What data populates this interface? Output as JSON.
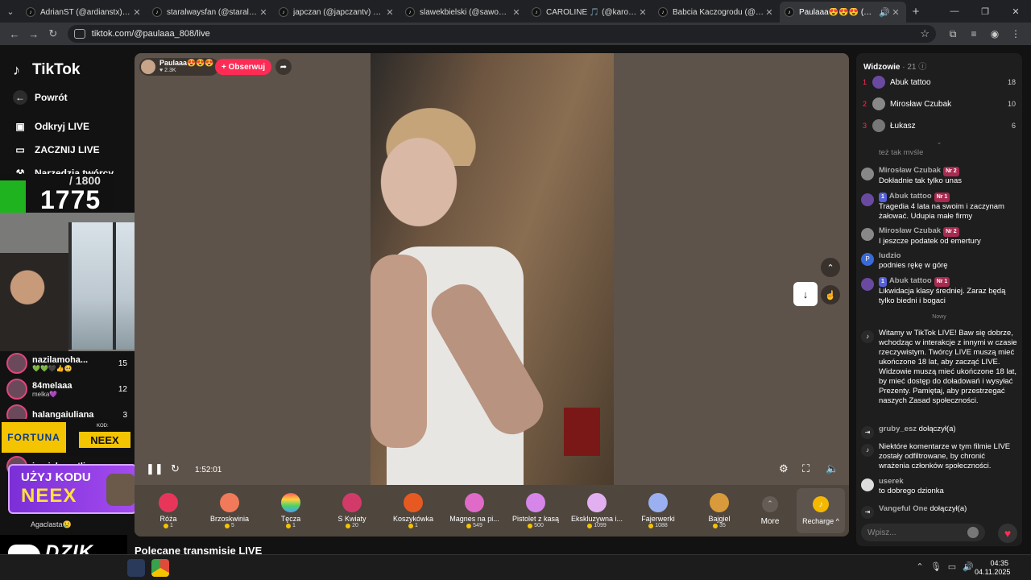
{
  "browser": {
    "tabs": [
      {
        "title": "AdrianST (@ardianstx) prowadz"
      },
      {
        "title": "staralwaysfan (@staralwaysfan)"
      },
      {
        "title": "japczan (@japczantv) prowadzi"
      },
      {
        "title": "slawekbielski (@sawomirbielski"
      },
      {
        "title": "CAROLINE 🎵 (@karolina.marc"
      },
      {
        "title": "Babcia Kaczogrodu (@balbinka"
      },
      {
        "title": "Paulaaa😍😍😍 (@paulaa"
      }
    ],
    "url": "tiktok.com/@paulaaa_808/live"
  },
  "nav": {
    "logo": "TikTok",
    "back": "Powrót",
    "discover": "Odkryj LIVE",
    "start": "ZACZNIJ LIVE",
    "tools": "Narzędzia twórcy",
    "partial": "W"
  },
  "overlay": {
    "counter_max": "/ 1800",
    "counter_value": "1775",
    "viewers": [
      {
        "name": "nazilamoha...",
        "sub": "💚💚🖤👍🥺",
        "count": "15"
      },
      {
        "name": "84melaaa",
        "sub": "melka💜",
        "count": "12"
      },
      {
        "name": "halangaiuliana",
        "sub": "",
        "count": "3"
      },
      {
        "name": "jarvjahwestli",
        "sub": "",
        "count": ""
      }
    ],
    "fortuna": "FORTUNA",
    "kod_label": "KOD:",
    "code": "NEEX",
    "promo_line1": "UŻYJ KODU",
    "promo_line2": "NEEX",
    "dzik": "DZIK",
    "agaclasta": "Agaclasta😢"
  },
  "player": {
    "host_name": "Paulaaa😍😍😍",
    "host_likes": "♥ 2.3K",
    "follow": "+ Obserwuj",
    "time": "1:52:01",
    "gifts": [
      {
        "name": "Róża",
        "price": "1",
        "color": "#e8365a"
      },
      {
        "name": "Brzoskwinia",
        "price": "5",
        "color": "#f07a5a"
      },
      {
        "name": "Tęcza",
        "price": "1",
        "color": "#ff9e3a"
      },
      {
        "name": "S Kwiaty",
        "price": "20",
        "color": "#d23a6a"
      },
      {
        "name": "Koszykówka",
        "price": "1",
        "color": "#e65a22"
      },
      {
        "name": "Magnes na pi...",
        "price": "549",
        "color": "#e06ac8"
      },
      {
        "name": "Pistolet z kasą",
        "price": "500",
        "color": "#d586e8"
      },
      {
        "name": "Ekskluzywna i...",
        "price": "1099",
        "color": "#e2b0f0"
      },
      {
        "name": "Fajerwerki",
        "price": "1088",
        "color": "#9ab0f0"
      },
      {
        "name": "Bajgiel",
        "price": "35",
        "color": "#d89a3a"
      }
    ],
    "more": "More",
    "recharge": "Recharge ^"
  },
  "recommended": "Polecane transmisje LIVE",
  "chat": {
    "header": "Widzowie",
    "header_count": "· 21",
    "top": [
      {
        "rank": "1",
        "name": "Abuk tattoo",
        "score": "18"
      },
      {
        "rank": "2",
        "name": "Mirosław Czubak",
        "score": "10"
      },
      {
        "rank": "3",
        "name": "Łukasz",
        "score": "6"
      }
    ],
    "cut_message": "też tak myślę",
    "messages": [
      {
        "who": "Mirosław Czubak",
        "lvl": "",
        "badge": "Nr 2",
        "text": "Dokładnie tak tylko unas"
      },
      {
        "who": "Abuk tattoo",
        "lvl": "1",
        "badge": "Nr 1",
        "text": "Tragedia 4 lata na swoim i zaczynam żałować. Udupia małe firmy"
      },
      {
        "who": "Mirosław Czubak",
        "lvl": "",
        "badge": "Nr 2",
        "text": "I jeszcze podatek od emertury"
      },
      {
        "who": "ludzio",
        "lvl": "",
        "badge": "",
        "text": "podnies rękę w górę"
      },
      {
        "who": "Abuk tattoo",
        "lvl": "1",
        "badge": "Nr 1",
        "text": "Likwidacja klasy średniej. Zaraz będą tylko biedni i bogaci"
      }
    ],
    "nowy": "Nowy",
    "system1": "Witamy w TikTok LIVE! Baw się dobrze, wchodząc w interakcje z innymi w czasie rzeczywistym. Twórcy LIVE muszą mieć ukończone 18 lat, aby zacząć LIVE. Widzowie muszą mieć ukończone 18 lat, by mieć dostęp do doładowań i wysyłać Prezenty. Pamiętaj, aby przestrzegać naszych Zasad społeczności.",
    "join1_name": "gruby_esz",
    "join1_text": "dołączył(a)",
    "system2": "Niektóre komentarze w tym filmie LIVE zostały odfiltrowane, by chronić wrażenia członków społeczności.",
    "user_msg_name": "userek",
    "user_msg_text": "to dobrego dzionka",
    "join2_name": "Vangeful One",
    "join2_text": "dołączył(a)",
    "input_placeholder": "Wpisz..."
  },
  "taskbar": {
    "time": "04:35",
    "date": "04.11.2025"
  }
}
